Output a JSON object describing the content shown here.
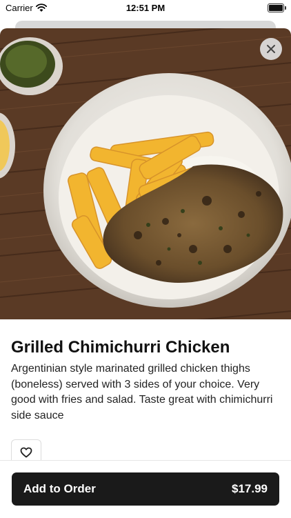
{
  "status_bar": {
    "carrier": "Carrier",
    "time": "12:51 PM",
    "icons": [
      "wifi-icon",
      "battery-icon"
    ]
  },
  "item": {
    "title": "Grilled Chimichurri Chicken",
    "description": "Argentinian style marinated grilled chicken thighs (boneless) served with 3 sides of your choice. Very good with fries and salad. Taste great with chimichurri side sauce",
    "image_alt": "Grilled chimichurri chicken with crinkle-cut fries and rice in a white bowl"
  },
  "actions": {
    "close_icon": "close-icon",
    "favorite_icon": "heart-icon",
    "add_label": "Add to Order",
    "price": "$17.99"
  },
  "colors": {
    "button": "#1a1a1a",
    "button_text": "#ffffff",
    "background": "#ffffff"
  }
}
